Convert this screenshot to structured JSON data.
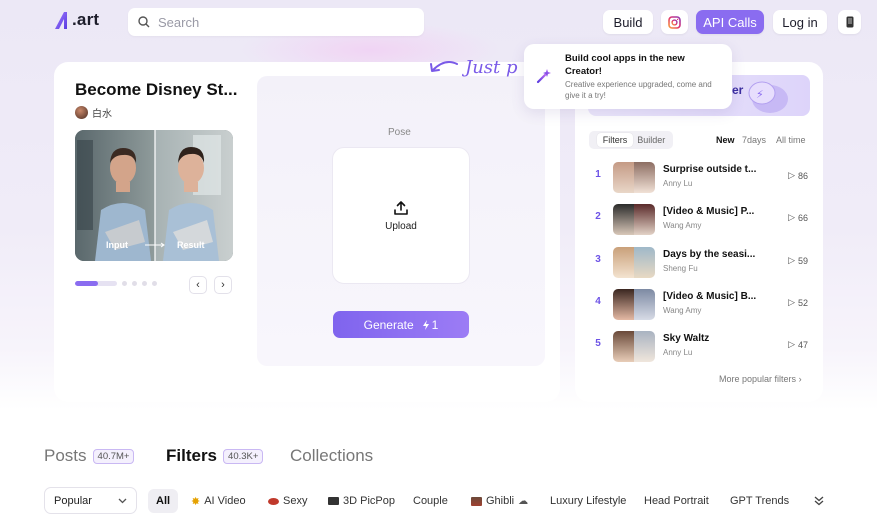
{
  "header": {
    "logo_text": ".art",
    "search_placeholder": "Search",
    "build_label": "Build",
    "api_label": "API Calls",
    "login_label": "Log in",
    "accent": "#8a6cf0"
  },
  "feature": {
    "title": "Become Disney St...",
    "author": "白水",
    "input_label": "Input",
    "result_label": "Result",
    "carousel_progress": 0.55,
    "carousel_pages": 5
  },
  "generator": {
    "pose_label": "Pose",
    "upload_label": "Upload",
    "generate_label": "Generate",
    "generate_cost": "1"
  },
  "callout": {
    "text": "Just p"
  },
  "popup": {
    "title": "Build cool apps in the new Creator!",
    "subtitle": "Creative experience upgraded, come and give it a try!"
  },
  "ranking": {
    "banner_text": "er",
    "tabs": [
      "Filters",
      "Builder"
    ],
    "time_filters": [
      "New",
      "7days",
      "All time"
    ],
    "items": [
      {
        "rank": "1",
        "title": "Surprise outside t...",
        "author": "Anny Lu",
        "plays": "86"
      },
      {
        "rank": "2",
        "title": "[Video & Music] P...",
        "author": "Wang Amy",
        "plays": "66"
      },
      {
        "rank": "3",
        "title": "Days by the seasi...",
        "author": "Sheng Fu",
        "plays": "59"
      },
      {
        "rank": "4",
        "title": "[Video & Music] B...",
        "author": "Wang Amy",
        "plays": "52"
      },
      {
        "rank": "5",
        "title": "Sky Waltz",
        "author": "Anny Lu",
        "plays": "47"
      }
    ],
    "more_label": "More popular filters"
  },
  "sections": {
    "posts_label": "Posts",
    "posts_count": "40.7M+",
    "filters_label": "Filters",
    "filters_count": "40.3K+",
    "collections_label": "Collections"
  },
  "filterbar": {
    "sort_value": "Popular",
    "chips": [
      "All",
      "AI Video",
      "Sexy",
      "3D PicPop",
      "Couple",
      "Ghibli",
      "Luxury Lifestyle",
      "Head Portrait",
      "GPT Trends"
    ]
  }
}
